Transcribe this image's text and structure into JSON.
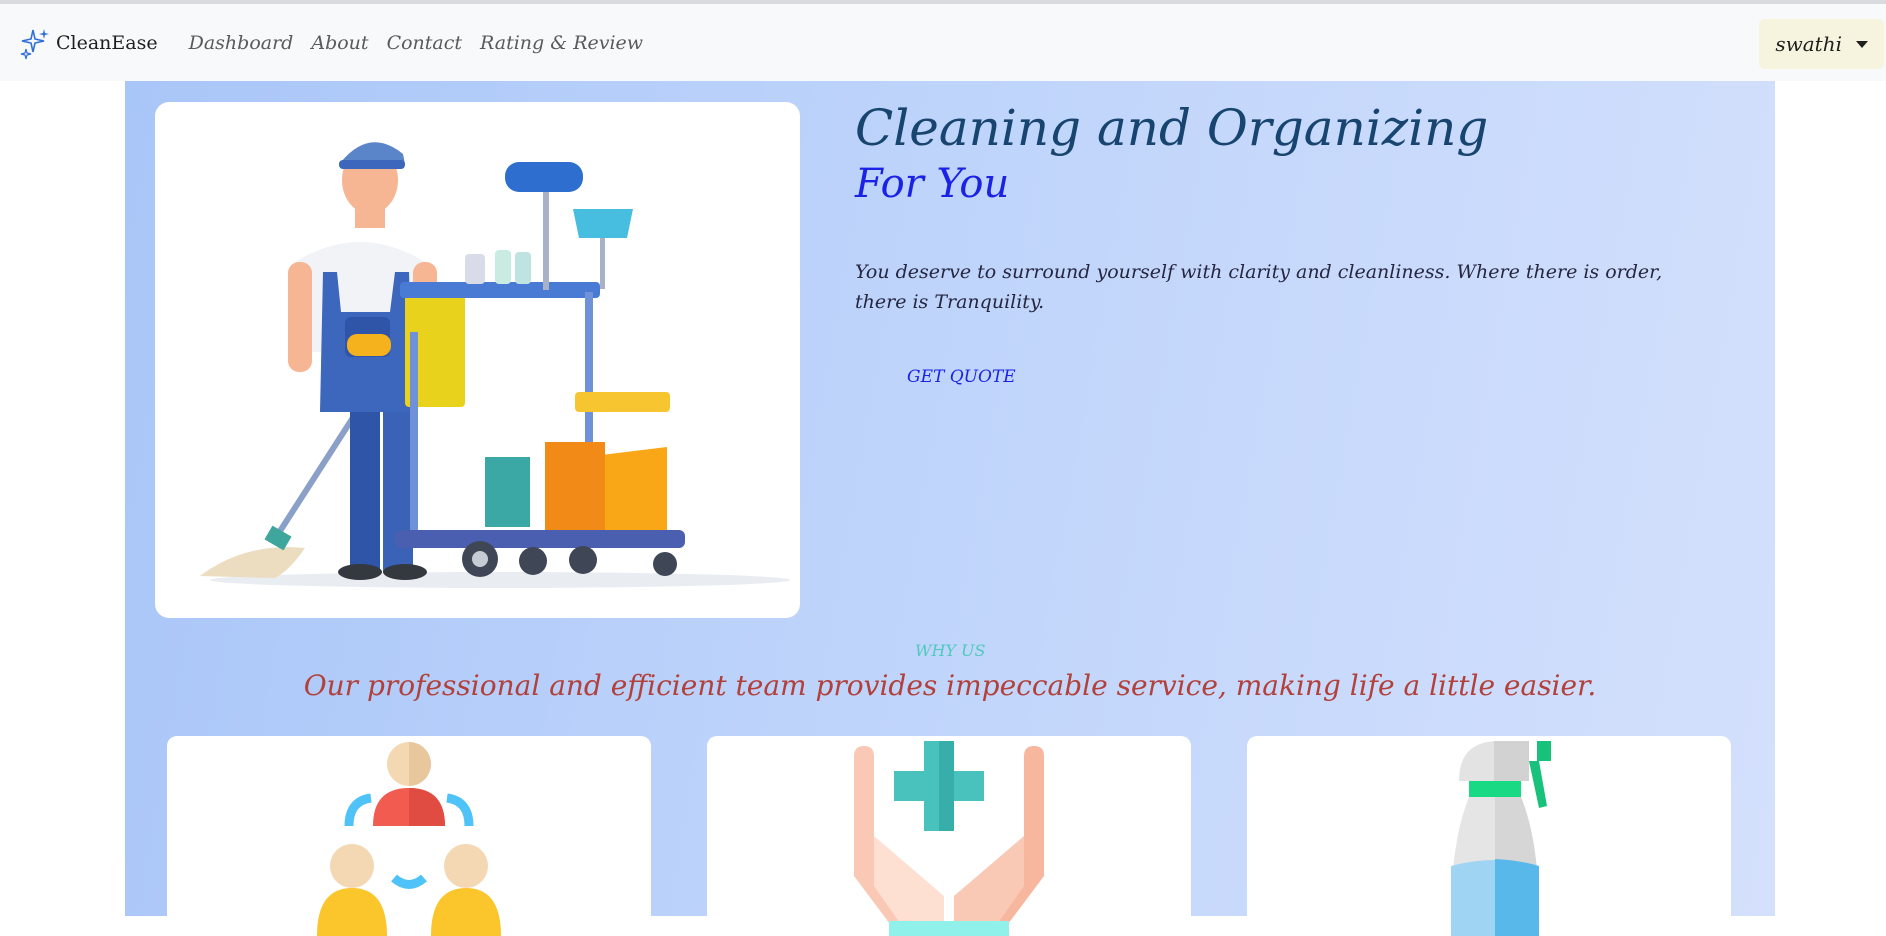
{
  "navbar": {
    "brand": {
      "name": "CleanEase",
      "icon": "sparkle-icon"
    },
    "links": [
      {
        "label": "Dashboard"
      },
      {
        "label": "About"
      },
      {
        "label": "Contact"
      },
      {
        "label": "Rating & Review"
      }
    ],
    "user": {
      "name": "swathi",
      "icon": "caret-down-icon"
    }
  },
  "hero": {
    "title": "Cleaning and Organizing",
    "subtitle": "For You",
    "description": "You deserve to surround yourself with clarity and cleanliness. Where there is order, there is Tranquility.",
    "cta_label": "GET QUOTE",
    "image": "janitor-with-cleaning-cart-illustration"
  },
  "why_us": {
    "tag": "WHY US",
    "heading": "Our professional and efficient team provides impeccable service, making life a little easier.",
    "cards": [
      {
        "icon": "team-people-icon"
      },
      {
        "icon": "hands-medical-cross-icon"
      },
      {
        "icon": "spray-bottle-icon"
      }
    ]
  },
  "colors": {
    "navbar_bg": "#f8f9fa",
    "hero_bg_start": "#a9c6f8",
    "hero_bg_end": "#d4e0fc",
    "title": "#17456f",
    "subtitle": "#1a22e6",
    "why_heading": "#b2403b",
    "why_tag": "#4fc9bd"
  }
}
